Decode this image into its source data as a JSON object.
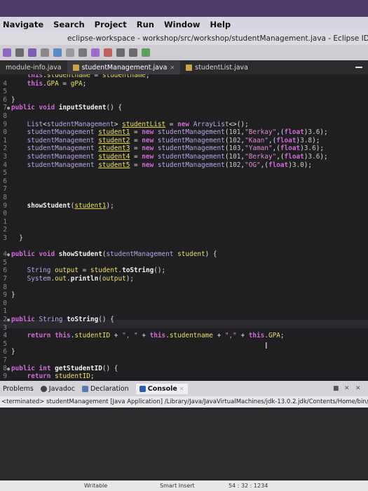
{
  "menu": [
    "Navigate",
    "Search",
    "Project",
    "Run",
    "Window",
    "Help"
  ],
  "window_title": "eclipse-workspace - workshop/src/workshop/studentManagement.java - Eclipse IDE",
  "editor_tabs": [
    {
      "label": "module-info.java",
      "active": false
    },
    {
      "label": "studentManagement.java",
      "active": true
    },
    {
      "label": "studentList.java",
      "active": false
    }
  ],
  "code_lines": [
    {
      "num": "",
      "text": "    this.studentname = studentname;"
    },
    {
      "num": "4",
      "text": "    this.GPA = gPA;"
    },
    {
      "num": "5",
      "text": ""
    },
    {
      "num": "6",
      "text": "}"
    },
    {
      "num": "7",
      "text": "public void inputStudent() {"
    },
    {
      "num": "8",
      "text": ""
    },
    {
      "num": "9",
      "text": "    List<studentManagement> studentList = new ArrayList<>();"
    },
    {
      "num": "0",
      "text": "    studentManagement student1 = new studentManagement(101,\"Berkay\",(float)3.6);"
    },
    {
      "num": "1",
      "text": "    studentManagement student2 = new studentManagement(102,\"Kaan\",(float)3.8);"
    },
    {
      "num": "2",
      "text": "    studentManagement student3 = new studentManagement(103,\"Yaman\",(float)3.6);"
    },
    {
      "num": "3",
      "text": "    studentManagement student4 = new studentManagement(101,\"Berkay\",(float)3.6);"
    },
    {
      "num": "4",
      "text": "    studentManagement student5 = new studentManagement(102,\"OG\",(float)3.0);"
    },
    {
      "num": "5",
      "text": ""
    },
    {
      "num": "6",
      "text": ""
    },
    {
      "num": "7",
      "text": ""
    },
    {
      "num": "8",
      "text": ""
    },
    {
      "num": "9",
      "text": "    showStudent(student1);"
    },
    {
      "num": "0",
      "text": ""
    },
    {
      "num": "1",
      "text": ""
    },
    {
      "num": "2",
      "text": ""
    },
    {
      "num": "3",
      "text": "  }"
    },
    {
      "num": "",
      "text": ""
    },
    {
      "num": "4",
      "text": "public void showStudent(studentManagement student) {"
    },
    {
      "num": "5",
      "text": ""
    },
    {
      "num": "6",
      "text": "    String output = student.toString();"
    },
    {
      "num": "7",
      "text": "    System.out.println(output);"
    },
    {
      "num": "8",
      "text": ""
    },
    {
      "num": "9",
      "text": "}"
    },
    {
      "num": "0",
      "text": ""
    },
    {
      "num": "1",
      "text": ""
    },
    {
      "num": "2",
      "text": "public String toString() {"
    },
    {
      "num": "3",
      "text": ""
    },
    {
      "num": "4",
      "text": "    return this.studentID + \", \" + this.studentname + \",\" + this.GPA;"
    },
    {
      "num": "5",
      "text": ""
    },
    {
      "num": "6",
      "text": "}"
    },
    {
      "num": "7",
      "text": ""
    },
    {
      "num": "8",
      "text": "public int getStudentID() {"
    },
    {
      "num": "9",
      "text": "    return studentID;"
    },
    {
      "num": "0",
      "text": "}"
    }
  ],
  "views": {
    "problems": "Problems",
    "javadoc": "Javadoc",
    "declaration": "Declaration",
    "console": "Console"
  },
  "console_info": "<terminated> studentManagement [Java Application] /Library/Java/JavaVirtualMachines/jdk-13.0.2.jdk/Contents/Home/bin/java",
  "status": {
    "writable": "Writable",
    "insert": "Smart Insert",
    "position": "54 : 32 : 1234"
  },
  "colors": {
    "keyword": "#d06bd6",
    "field": "#e9e06b",
    "string": "#e08ad0",
    "background": "#1f1f22"
  }
}
